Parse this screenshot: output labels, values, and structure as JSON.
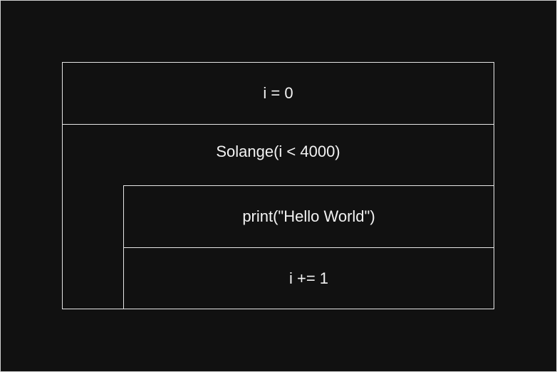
{
  "diagram": {
    "init_statement": "i = 0",
    "loop_condition": "Solange(i < 4000)",
    "body": [
      "print(\"Hello World\")",
      "i += 1"
    ]
  }
}
